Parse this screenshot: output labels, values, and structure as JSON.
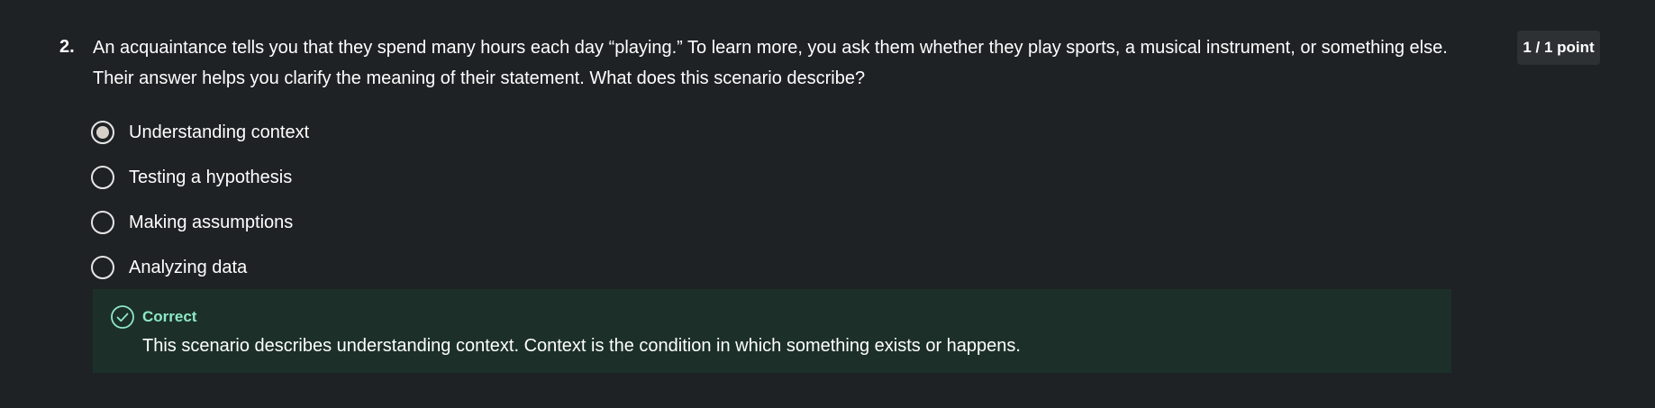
{
  "question": {
    "number": "2.",
    "text": "An acquaintance tells you that they spend many hours each day “playing.” To learn more, you ask them whether they play sports, a musical instrument, or something else. Their answer helps you clarify the meaning of their statement. What does this scenario describe?",
    "points": "1 / 1 point",
    "selected_index": 0,
    "options": [
      {
        "label": "Understanding context"
      },
      {
        "label": "Testing a hypothesis"
      },
      {
        "label": "Making assumptions"
      },
      {
        "label": "Analyzing data"
      }
    ]
  },
  "feedback": {
    "icon": "check-circle-icon",
    "status": "Correct",
    "text": "This scenario describes understanding context. Context is the condition in which something exists or happens.",
    "status_color": "#8ee8c8",
    "background_color": "#1c3029"
  }
}
